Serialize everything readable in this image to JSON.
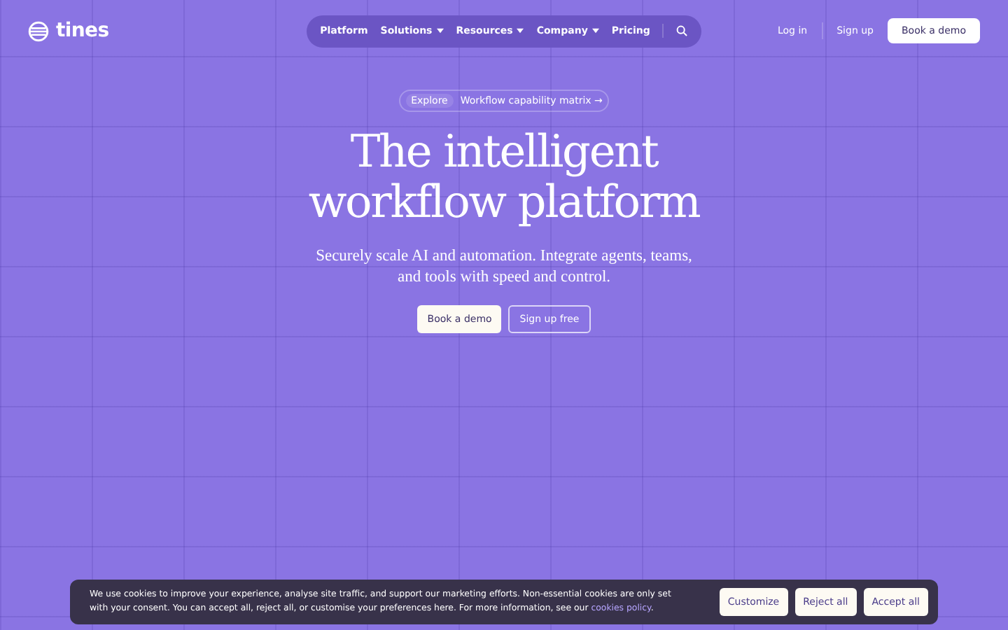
{
  "logo": {
    "text": "tines"
  },
  "nav": {
    "items": [
      {
        "label": "Platform",
        "kind": "link"
      },
      {
        "label": "Solutions",
        "kind": "dropdown"
      },
      {
        "label": "Resources",
        "kind": "dropdown"
      },
      {
        "label": "Company",
        "kind": "dropdown"
      },
      {
        "label": "Pricing",
        "kind": "link"
      }
    ]
  },
  "header_actions": {
    "log_in": "Log in",
    "sign_up": "Sign up",
    "book_demo": "Book a demo"
  },
  "announcement": {
    "tag": "Explore",
    "link": "Workflow capability matrix",
    "arrow": "→"
  },
  "hero": {
    "title_lines": [
      "The intelligent",
      "workflow platform"
    ],
    "subtitle_lines": [
      "Securely scale AI and automation. Integrate agents, teams,",
      "and tools with speed and control."
    ],
    "primary_button": "Book a demo",
    "secondary_button": "Sign up free"
  },
  "cookie_banner": {
    "text": "We use cookies to improve your experience, analyse site traffic, and support our marketing efforts. Non-essential cookies are only set with your consent. You can accept all, reject all, or customise your preferences here. For more information, see our",
    "link": "cookies policy",
    "after_link": ".",
    "buttons": [
      "Customize",
      "Reject all",
      "Accept all"
    ]
  }
}
